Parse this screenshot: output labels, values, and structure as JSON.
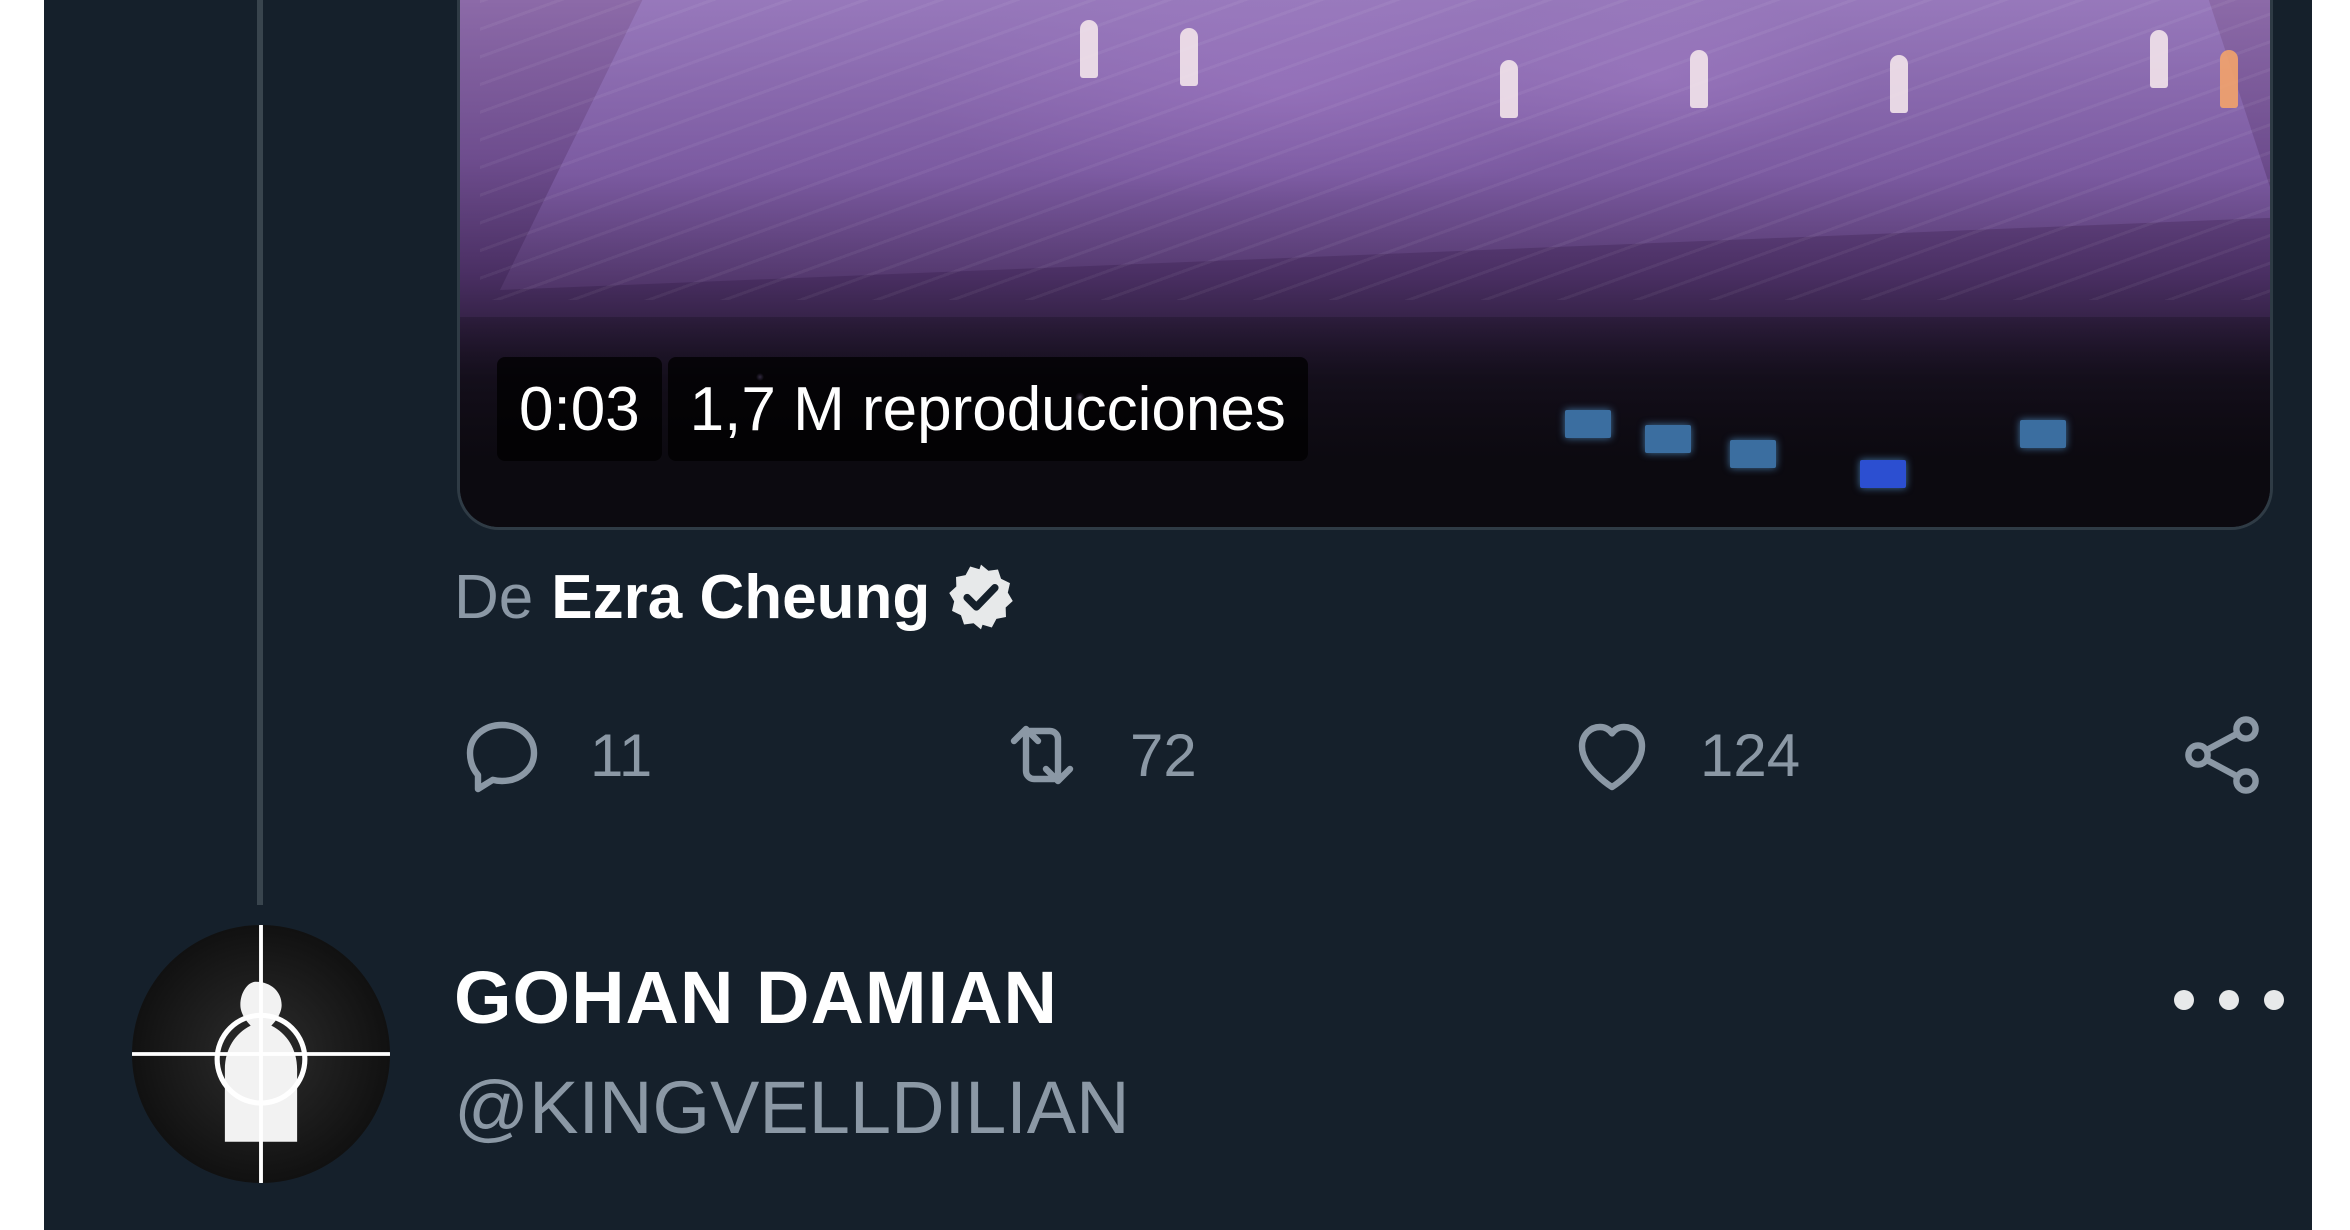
{
  "video": {
    "duration": "0:03",
    "views": "1,7 M reproducciones"
  },
  "attribution": {
    "prefix": "De",
    "name": "Ezra Cheung",
    "verified_icon": "verified-badge-icon"
  },
  "actions": {
    "reply": {
      "icon": "reply-icon",
      "count": "11"
    },
    "retweet": {
      "icon": "retweet-icon",
      "count": "72"
    },
    "like": {
      "icon": "heart-icon",
      "count": "124"
    },
    "share": {
      "icon": "share-icon"
    }
  },
  "author": {
    "display_name": "GOHAN DAMIAN",
    "handle": "@KINGVELLDILIAN",
    "more_icon": "more-options-icon"
  },
  "colors": {
    "background": "#15202b",
    "text_primary": "#ffffff",
    "text_secondary": "#8b98a5",
    "thread_line": "#38444d"
  }
}
